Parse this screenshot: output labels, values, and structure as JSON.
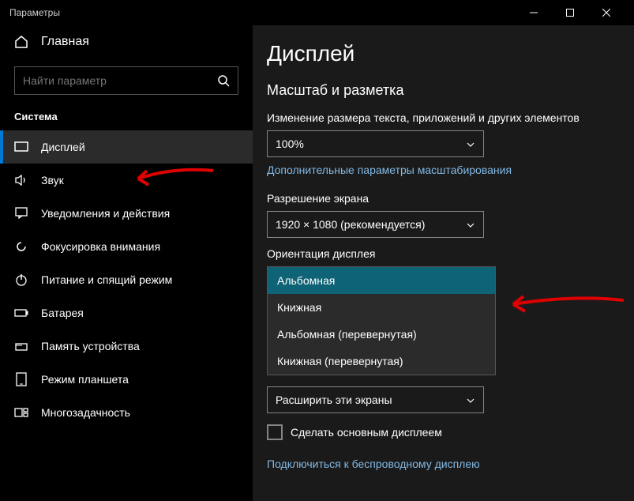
{
  "window": {
    "title": "Параметры"
  },
  "sidebar": {
    "home": "Главная",
    "search_placeholder": "Найти параметр",
    "section": "Система",
    "items": [
      {
        "label": "Дисплей"
      },
      {
        "label": "Звук"
      },
      {
        "label": "Уведомления и действия"
      },
      {
        "label": "Фокусировка внимания"
      },
      {
        "label": "Питание и спящий режим"
      },
      {
        "label": "Батарея"
      },
      {
        "label": "Память устройства"
      },
      {
        "label": "Режим планшета"
      },
      {
        "label": "Многозадачность"
      }
    ]
  },
  "main": {
    "title": "Дисплей",
    "section": "Масштаб и разметка",
    "scale_label": "Изменение размера текста, приложений и других элементов",
    "scale_value": "100%",
    "scale_link": "Дополнительные параметры масштабирования",
    "resolution_label": "Разрешение экрана",
    "resolution_value": "1920 × 1080 (рекомендуется)",
    "orientation_label": "Ориентация дисплея",
    "orientation_options": [
      "Альбомная",
      "Книжная",
      "Альбомная (перевернутая)",
      "Книжная (перевернутая)"
    ],
    "multi_display_value": "Расширить эти экраны",
    "primary_checkbox": "Сделать основным дисплеем",
    "wireless_link": "Подключиться к беспроводному дисплею"
  },
  "colors": {
    "accent": "#0078d4",
    "dropdown_sel": "#0f6376",
    "link": "#82b9e4"
  }
}
